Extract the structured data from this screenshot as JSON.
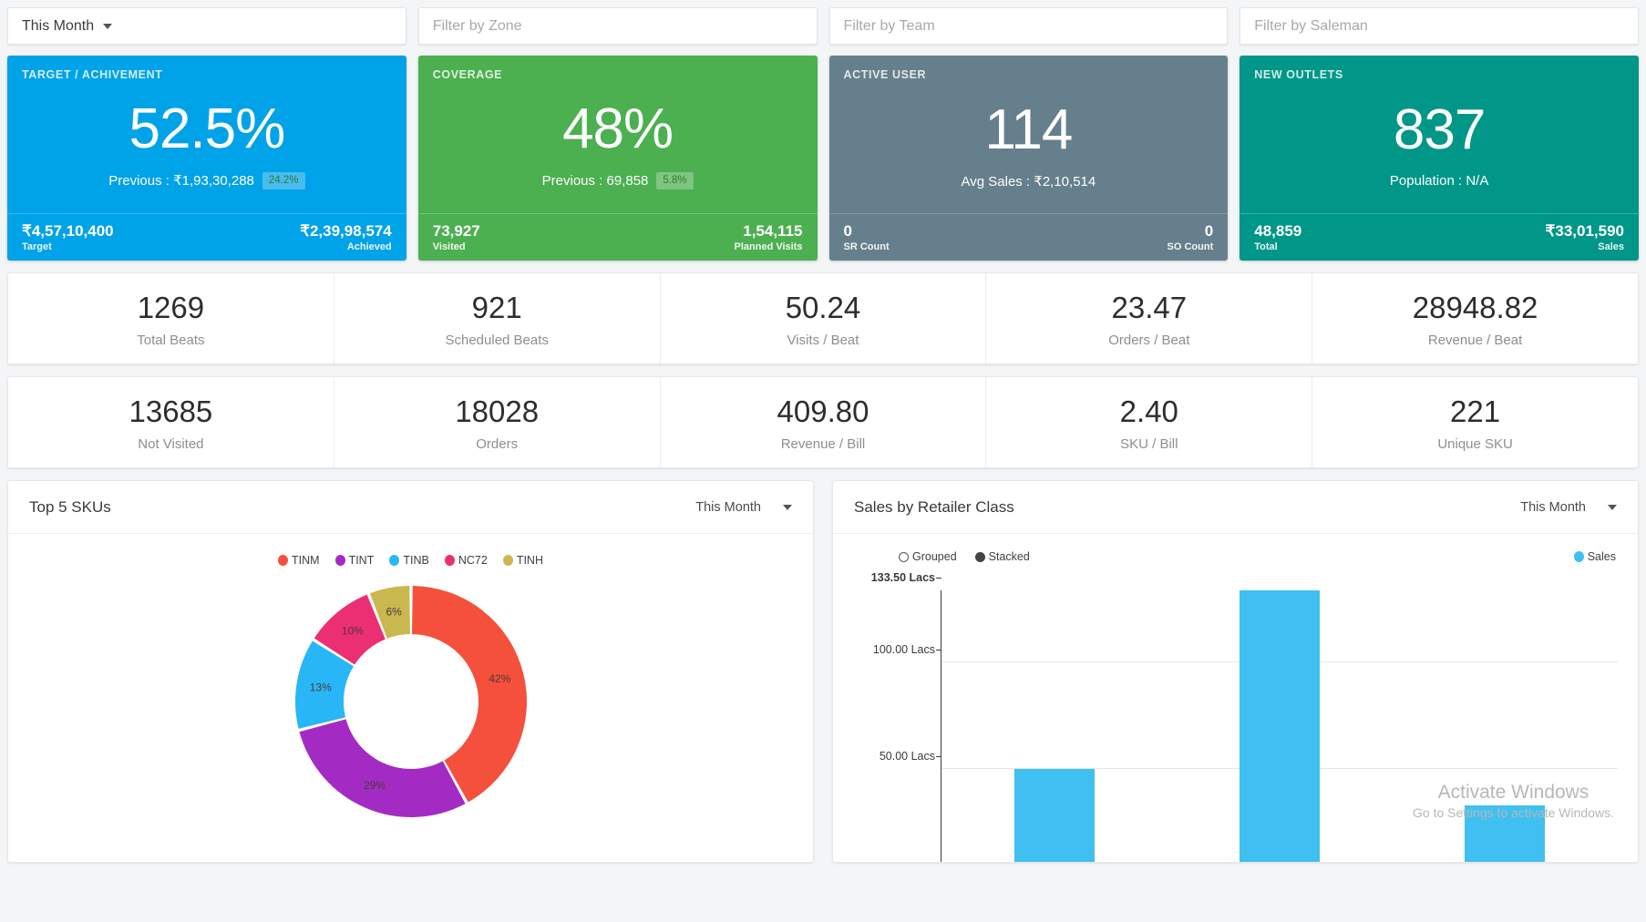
{
  "filters": [
    {
      "name": "period",
      "value": "This Month",
      "placeholder": "",
      "has_caret": true
    },
    {
      "name": "zone",
      "value": "",
      "placeholder": "Filter by Zone",
      "has_caret": false
    },
    {
      "name": "team",
      "value": "",
      "placeholder": "Filter by Team",
      "has_caret": false
    },
    {
      "name": "saleman",
      "value": "",
      "placeholder": "Filter by Saleman",
      "has_caret": false
    }
  ],
  "kpi_cards": [
    {
      "title": "TARGET / ACHIVEMENT",
      "value": "52.5%",
      "sub": "Previous : ₹1,93,30,288",
      "badge": "24.2%",
      "color": "#00a2e8",
      "left_value": "₹4,57,10,400",
      "left_label": "Target",
      "right_value": "₹2,39,98,574",
      "right_label": "Achieved"
    },
    {
      "title": "COVERAGE",
      "value": "48%",
      "sub": "Previous : 69,858",
      "badge": "5.8%",
      "color": "#4caf50",
      "left_value": "73,927",
      "left_label": "Visited",
      "right_value": "1,54,115",
      "right_label": "Planned Visits"
    },
    {
      "title": "ACTIVE USER",
      "value": "114",
      "sub": "Avg Sales : ₹2,10,514",
      "badge": "",
      "color": "#667f8c",
      "left_value": "0",
      "left_label": "SR Count",
      "right_value": "0",
      "right_label": "SO Count"
    },
    {
      "title": "NEW OUTLETS",
      "value": "837",
      "sub": "Population : N/A",
      "badge": "",
      "color": "#009688",
      "left_value": "48,859",
      "left_label": "Total",
      "right_value": "₹33,01,590",
      "right_label": "Sales"
    }
  ],
  "metrics_row1": [
    {
      "value": "1269",
      "label": "Total Beats"
    },
    {
      "value": "921",
      "label": "Scheduled Beats"
    },
    {
      "value": "50.24",
      "label": "Visits / Beat"
    },
    {
      "value": "23.47",
      "label": "Orders / Beat"
    },
    {
      "value": "28948.82",
      "label": "Revenue / Beat"
    }
  ],
  "metrics_row2": [
    {
      "value": "13685",
      "label": "Not Visited"
    },
    {
      "value": "18028",
      "label": "Orders"
    },
    {
      "value": "409.80",
      "label": "Revenue / Bill"
    },
    {
      "value": "2.40",
      "label": "SKU / Bill"
    },
    {
      "value": "221",
      "label": "Unique SKU"
    }
  ],
  "sku_panel": {
    "title": "Top 5 SKUs",
    "period": "This Month"
  },
  "retailer_panel": {
    "title": "Sales by Retailer Class",
    "period": "This Month",
    "mode_options": [
      {
        "label": "Grouped",
        "selected": false
      },
      {
        "label": "Stacked",
        "selected": true
      }
    ],
    "series_legend": "Sales",
    "series_color": "#3fc0f0"
  },
  "watermark": {
    "title": "Activate Windows",
    "subtitle": "Go to Settings to activate Windows."
  },
  "chart_data": [
    {
      "type": "pie",
      "title": "Top 5 SKUs",
      "labels": [
        "TINM",
        "TINT",
        "TINB",
        "NC72",
        "TINH"
      ],
      "values": [
        42,
        29,
        13,
        10,
        6
      ],
      "value_labels": [
        "42%",
        "29%",
        "13%",
        "10%",
        "6%"
      ],
      "colors": [
        "#f4503c",
        "#a32bc4",
        "#29b6f6",
        "#ec2f72",
        "#c9b84e"
      ],
      "donut": true,
      "legend_position": "top-center"
    },
    {
      "type": "bar",
      "title": "Sales by Retailer Class",
      "series": [
        {
          "name": "Sales",
          "values": [
            50.0,
            133.5,
            33.0
          ]
        }
      ],
      "categories": [
        "",
        "",
        ""
      ],
      "ylabel": "",
      "xlabel": "",
      "ylim": [
        0,
        133.5
      ],
      "yticks": [
        50.0,
        100.0,
        133.5
      ],
      "ytick_labels": [
        "50.00 Lacs",
        "100.00 Lacs",
        "133.50 Lacs"
      ],
      "grid": true,
      "legend_position": "top-right",
      "unit": "Lacs"
    }
  ]
}
